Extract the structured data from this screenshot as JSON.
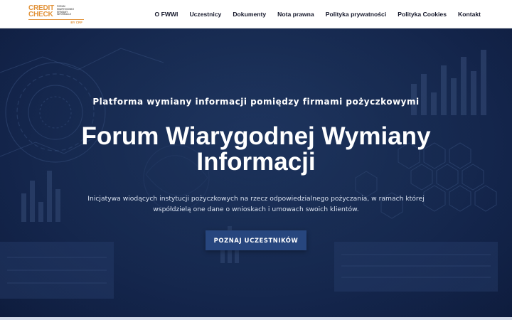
{
  "logo": {
    "line1": "CREDIT",
    "line2": "CHECK",
    "sub1": "FORUM",
    "sub2": "WIARYGODNEJ",
    "sub3": "WYMIANY",
    "sub4": "INFORMACJI",
    "by": "BY CRF"
  },
  "nav": {
    "items": [
      {
        "label": "O FWWI"
      },
      {
        "label": "Uczestnicy"
      },
      {
        "label": "Dokumenty"
      },
      {
        "label": "Nota prawna"
      },
      {
        "label": "Polityka prywatności"
      },
      {
        "label": "Polityka Cookies"
      },
      {
        "label": "Kontakt"
      }
    ]
  },
  "hero": {
    "kicker": "Platforma wymiany informacji pomiędzy firmami pożyczkowymi",
    "title": "Forum Wiarygodnej Wymiany Informacji",
    "lead": "Inicjatywa wiodących instytucji pożyczkowych na rzecz odpowiedzialnego pożyczania, w ramach której współdzielą one dane o wnioskach i umowach swoich klientów.",
    "cta_label": "POZNAJ UCZESTNIKÓW"
  },
  "colors": {
    "accent_orange": "#e2933a",
    "hero_navy": "#1a2f57",
    "button_blue": "#27467e",
    "nav_text": "#14172a"
  }
}
